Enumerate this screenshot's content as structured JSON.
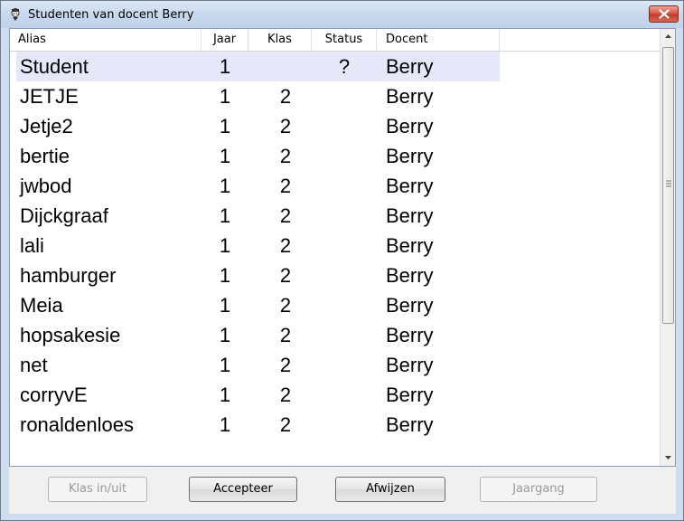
{
  "window": {
    "title": "Studenten van docent Berry"
  },
  "columns": {
    "alias": "Alias",
    "jaar": "Jaar",
    "klas": "Klas",
    "status": "Status",
    "docent": "Docent"
  },
  "rows": [
    {
      "alias": "Student",
      "jaar": "1",
      "klas": "",
      "status": "?",
      "docent": "Berry"
    },
    {
      "alias": "JETJE",
      "jaar": "1",
      "klas": "2",
      "status": "",
      "docent": "Berry"
    },
    {
      "alias": "Jetje2",
      "jaar": "1",
      "klas": "2",
      "status": "",
      "docent": "Berry"
    },
    {
      "alias": "bertie",
      "jaar": "1",
      "klas": "2",
      "status": "",
      "docent": "Berry"
    },
    {
      "alias": "jwbod",
      "jaar": "1",
      "klas": "2",
      "status": "",
      "docent": "Berry"
    },
    {
      "alias": "Dijckgraaf",
      "jaar": "1",
      "klas": "2",
      "status": "",
      "docent": "Berry"
    },
    {
      "alias": "lali",
      "jaar": "1",
      "klas": "2",
      "status": "",
      "docent": "Berry"
    },
    {
      "alias": "hamburger",
      "jaar": "1",
      "klas": "2",
      "status": "",
      "docent": "Berry"
    },
    {
      "alias": "Meia",
      "jaar": "1",
      "klas": "2",
      "status": "",
      "docent": "Berry"
    },
    {
      "alias": "hopsakesie",
      "jaar": "1",
      "klas": "2",
      "status": "",
      "docent": "Berry"
    },
    {
      "alias": "net",
      "jaar": "1",
      "klas": "2",
      "status": "",
      "docent": "Berry"
    },
    {
      "alias": "corryvE",
      "jaar": "1",
      "klas": "2",
      "status": "",
      "docent": "Berry"
    },
    {
      "alias": "ronaldenloes",
      "jaar": "1",
      "klas": "2",
      "status": "",
      "docent": "Berry"
    }
  ],
  "buttons": {
    "klas": {
      "label": "Klas in/uit",
      "enabled": false
    },
    "accepteer": {
      "label": "Accepteer",
      "enabled": true
    },
    "afwijzen": {
      "label": "Afwijzen",
      "enabled": true
    },
    "jaargang": {
      "label": "Jaargang",
      "enabled": false
    }
  },
  "colors": {
    "selection": "#e6e8fa",
    "close": "#c23b2b"
  }
}
